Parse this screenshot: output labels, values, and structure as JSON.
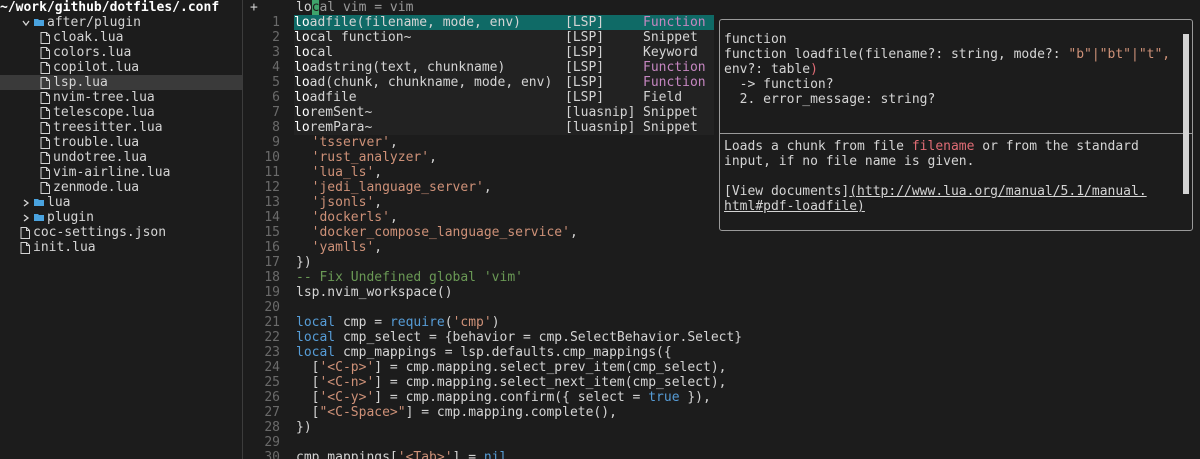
{
  "tree": {
    "title": "~/work/github/dotfiles/.conf",
    "items": [
      {
        "label": "after/plugin",
        "type": "folder-open",
        "indent": 1
      },
      {
        "label": "cloak.lua",
        "type": "file",
        "indent": 3
      },
      {
        "label": "colors.lua",
        "type": "file",
        "indent": 3
      },
      {
        "label": "copilot.lua",
        "type": "file",
        "indent": 3
      },
      {
        "label": "lsp.lua",
        "type": "file",
        "indent": 3,
        "selected": true
      },
      {
        "label": "nvim-tree.lua",
        "type": "file",
        "indent": 3
      },
      {
        "label": "telescope.lua",
        "type": "file",
        "indent": 3
      },
      {
        "label": "treesitter.lua",
        "type": "file",
        "indent": 3
      },
      {
        "label": "trouble.lua",
        "type": "file",
        "indent": 3
      },
      {
        "label": "undotree.lua",
        "type": "file",
        "indent": 3
      },
      {
        "label": "vim-airline.lua",
        "type": "file",
        "indent": 3
      },
      {
        "label": "zenmode.lua",
        "type": "file",
        "indent": 3
      },
      {
        "label": "lua",
        "type": "folder-closed",
        "indent": 1
      },
      {
        "label": "plugin",
        "type": "folder-closed",
        "indent": 1
      },
      {
        "label": "coc-settings.json",
        "type": "file",
        "indent": 1
      },
      {
        "label": "init.lua",
        "type": "file",
        "indent": 1
      }
    ]
  },
  "editor": {
    "lines": [
      {
        "n": "+",
        "code": "",
        "special": "cursor"
      },
      {
        "n": "1",
        "code": ""
      },
      {
        "n": "2",
        "code": ""
      },
      {
        "n": "3",
        "code": ""
      },
      {
        "n": "4",
        "code": ""
      },
      {
        "n": "5",
        "code": ""
      },
      {
        "n": "6",
        "code": ""
      },
      {
        "n": "7",
        "code": ""
      },
      {
        "n": "8",
        "code": ""
      },
      {
        "n": "9",
        "code": "  'tsserver',"
      },
      {
        "n": "10",
        "code": "  'rust_analyzer',"
      },
      {
        "n": "11",
        "code": "  'lua_ls',"
      },
      {
        "n": "12",
        "code": "  'jedi_language_server',"
      },
      {
        "n": "13",
        "code": "  'jsonls',"
      },
      {
        "n": "14",
        "code": "  'dockerls',"
      },
      {
        "n": "15",
        "code": "  'docker_compose_language_service',"
      },
      {
        "n": "16",
        "code": "  'yamlls',"
      },
      {
        "n": "17",
        "code": "})"
      },
      {
        "n": "18",
        "code": "-- Fix Undefined global 'vim'"
      },
      {
        "n": "19",
        "code": "lsp.nvim_workspace()"
      },
      {
        "n": "20",
        "code": ""
      },
      {
        "n": "21",
        "code": "local cmp = require('cmp')"
      },
      {
        "n": "22",
        "code": "local cmp_select = {behavior = cmp.SelectBehavior.Select}"
      },
      {
        "n": "23",
        "code": "local cmp_mappings = lsp.defaults.cmp_mappings({"
      },
      {
        "n": "24",
        "code": "  ['<C-p>'] = cmp.mapping.select_prev_item(cmp_select),"
      },
      {
        "n": "25",
        "code": "  ['<C-n>'] = cmp.mapping.select_next_item(cmp_select),"
      },
      {
        "n": "26",
        "code": "  ['<C-y>'] = cmp.mapping.confirm({ select = true }),"
      },
      {
        "n": "27",
        "code": "  [\"<C-Space>\"] = cmp.mapping.complete(),"
      },
      {
        "n": "28",
        "code": "})"
      },
      {
        "n": "29",
        "code": ""
      },
      {
        "n": "30",
        "code": "cmp_mappings['<Tab>'] = nil"
      }
    ],
    "cursor_line": {
      "before": "lo",
      "cursor": "c",
      "after": "al vim = vim"
    }
  },
  "menu": {
    "items": [
      {
        "prefix": "lo",
        "rest": "adfile(filename, mode, env)",
        "source": "[LSP]",
        "kind": "Function",
        "active": true
      },
      {
        "prefix": "lo",
        "rest": "cal function~",
        "source": "[LSP]",
        "kind": "Snippet"
      },
      {
        "prefix": "lo",
        "rest": "cal",
        "source": "[LSP]",
        "kind": "Keyword"
      },
      {
        "prefix": "lo",
        "rest": "adstring(text, chunkname)",
        "source": "[LSP]",
        "kind": "Function"
      },
      {
        "prefix": "lo",
        "rest": "ad(chunk, chunkname, mode, env)",
        "source": "[LSP]",
        "kind": "Function"
      },
      {
        "prefix": "lo",
        "rest": "adfile",
        "source": "[LSP]",
        "kind": "Field"
      },
      {
        "prefix": "lo",
        "rest": "remSent~",
        "source": "[luasnip]",
        "kind": "Snippet"
      },
      {
        "prefix": "lo",
        "rest": "remPara~",
        "source": "[luasnip]",
        "kind": "Snippet"
      }
    ]
  },
  "doc": {
    "kind": "function",
    "sig1": "function loadfile(filename?: string, mode?: ",
    "sig1_str": "\"b\"|\"bt\"|\"t\",",
    "sig2a": "env?: table",
    "sig2b": ")",
    "ret1": "  -> function?",
    "ret2": "  2. error_message: string?",
    "desc1a": "Loads a chunk from file ",
    "desc1_name": "filename",
    "desc1b": " or from the standard",
    "desc2": "input, if no file name is given.",
    "link_label": "[View documents]",
    "link_url1": "(http://www.lua.org/manual/5.1/manual.",
    "link_url2": "html#pdf-loadfile)"
  },
  "colors": {
    "menu_active": "#0f6a66",
    "cursor": "#3fa36b",
    "folder": "#4aa3df"
  }
}
